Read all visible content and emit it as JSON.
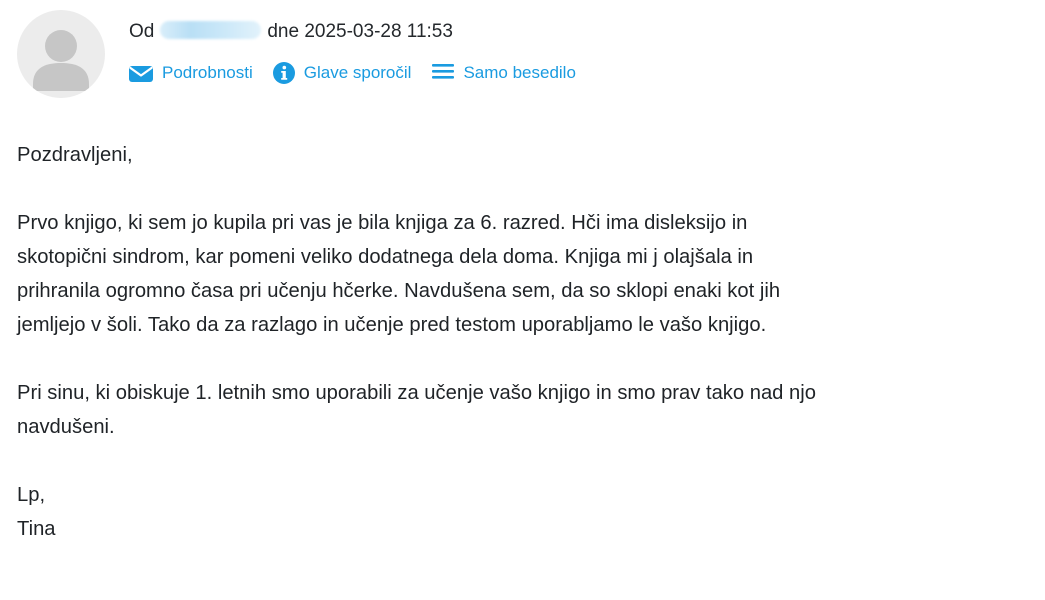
{
  "header": {
    "from_prefix": "Od",
    "sender_name": "Tina Rozel",
    "date_text": "dne 2025-03-28 11:53"
  },
  "actions": {
    "details_label": "Podrobnosti",
    "headers_label": "Glave sporočil",
    "plaintext_label": "Samo besedilo"
  },
  "icons": {
    "details": "envelope-icon",
    "headers": "info-icon",
    "plaintext": "lines-icon",
    "avatar": "user-avatar-icon"
  },
  "colors": {
    "accent": "#1a9be0",
    "text": "#1f2327",
    "avatar_bg": "#ececec",
    "avatar_fg": "#c6c6c6"
  },
  "message": {
    "greeting": "Pozdravljeni,",
    "paragraph1_lines": [
      "Prvo knjigo, ki sem jo kupila pri vas je bila knjiga za 6. razred. Hči ima disleksijo in",
      "skotopični sindrom, kar pomeni veliko dodatnega dela doma. Knjiga mi j olajšala in",
      "prihranila ogromno časa pri učenju hčerke. Navdušena sem, da so sklopi enaki kot jih",
      "jemljejo v šoli. Tako da za razlago in učenje pred testom uporabljamo le vašo knjigo."
    ],
    "paragraph2_lines": [
      "Pri sinu, ki obiskuje 1. letnih smo uporabili za učenje vašo knjigo in smo prav tako nad njo",
      "navdušeni."
    ],
    "signoff": "Lp,",
    "signature": "Tina"
  }
}
